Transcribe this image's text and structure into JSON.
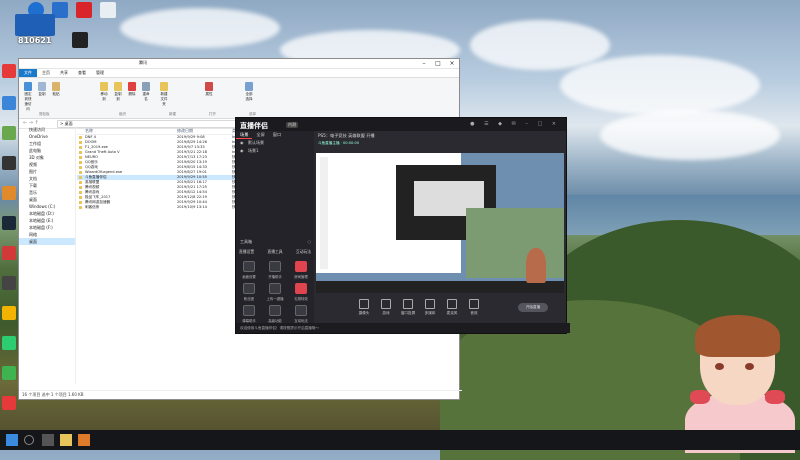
{
  "desktop": {
    "top_icons": [
      {
        "label": "",
        "color": "#cfd2d6"
      },
      {
        "label": "",
        "color": "#1e6fd0"
      },
      {
        "label": "",
        "color": "#2a6fc9"
      },
      {
        "label": "",
        "color": "#d9252a"
      },
      {
        "label": "",
        "color": "#3a7bd5"
      }
    ],
    "brand_text": "810621",
    "left_icons": [
      {
        "label": "",
        "color": "#e63a3a"
      },
      {
        "label": "",
        "color": "#3b86d8"
      },
      {
        "label": "",
        "color": "#6aa84f"
      },
      {
        "label": "",
        "color": "#333333"
      },
      {
        "label": "",
        "color": "#0f3d6e"
      },
      {
        "label": "",
        "color": "#e08a2b"
      },
      {
        "label": "",
        "color": "#1b2838"
      },
      {
        "label": "",
        "color": "#d23a3a"
      },
      {
        "label": "",
        "color": "#444444"
      },
      {
        "label": "",
        "color": "#f2b400"
      },
      {
        "label": "",
        "color": "#2ecc71"
      },
      {
        "label": "",
        "color": "#3fb34f"
      }
    ]
  },
  "explorer": {
    "title": "腾讯",
    "ribbon_tabs": [
      "文件",
      "主页",
      "共享",
      "查看",
      "管理"
    ],
    "ribbon_groups": [
      "剪贴板",
      "组织",
      "新建",
      "打开",
      "选择"
    ],
    "ribbon_buttons": [
      "固定到快速访问",
      "复制",
      "粘贴",
      "移动到",
      "复制到",
      "删除",
      "重命名",
      "新建文件夹",
      "属性",
      "全部选择"
    ],
    "address": "> 桌面",
    "search_placeholder": "搜索\"桌面\"",
    "nav": [
      {
        "label": "快速访问",
        "selected": false
      },
      {
        "label": "OneDrive",
        "selected": false
      },
      {
        "label": "工作组",
        "selected": false
      },
      {
        "label": "此电脑",
        "selected": false
      },
      {
        "label": "3D 对象",
        "selected": false
      },
      {
        "label": "视频",
        "selected": false
      },
      {
        "label": "图片",
        "selected": false
      },
      {
        "label": "文档",
        "selected": false
      },
      {
        "label": "下载",
        "selected": false
      },
      {
        "label": "音乐",
        "selected": false
      },
      {
        "label": "桌面",
        "selected": false
      },
      {
        "label": "Windows (C:)",
        "selected": false
      },
      {
        "label": "本地磁盘 (D:)",
        "selected": false
      },
      {
        "label": "本地磁盘 (E:)",
        "selected": false
      },
      {
        "label": "本地磁盘 (F:)",
        "selected": false
      },
      {
        "label": "网络",
        "selected": false
      },
      {
        "label": "桌面",
        "selected": true
      }
    ],
    "columns": [
      "名称",
      "修改日期",
      "类型",
      "大小"
    ],
    "files": [
      {
        "name": "DNF 4",
        "date": "2019/9/29 9:08",
        "type": "Internet 快捷方式",
        "size": "",
        "selected": false
      },
      {
        "name": "DOOM",
        "date": "2019/8/29 14:26",
        "type": "Internet 快捷方式",
        "size": "",
        "selected": false
      },
      {
        "name": "F1_2019.exe",
        "date": "2019/9/7 13:33",
        "type": "快捷方式",
        "size": "",
        "selected": false
      },
      {
        "name": "Grand Theft Auto V",
        "date": "2019/5/21 22:18",
        "type": "Internet 快捷方式",
        "size": "",
        "selected": false
      },
      {
        "name": "NEURO",
        "date": "2019/7/13 17:23",
        "type": "快捷方式",
        "size": "",
        "selected": false
      },
      {
        "name": "QQ音乐",
        "date": "2019/6/20 13:19",
        "type": "快捷方式",
        "size": "",
        "selected": false
      },
      {
        "name": "QQ游戏",
        "date": "2019/8/15 14:33",
        "type": "快捷方式",
        "size": "",
        "selected": false
      },
      {
        "name": "WizardOfLegend.exe",
        "date": "2019/8/27 19:01",
        "type": "快捷方式",
        "size": "",
        "selected": false
      },
      {
        "name": "斗鱼直播伴侣",
        "date": "2019/9/29 10:55",
        "type": "快捷方式",
        "size": "",
        "selected": true
      },
      {
        "name": "英雄联盟",
        "date": "2019/8/21 16:17",
        "type": "快捷方式",
        "size": "",
        "selected": false
      },
      {
        "name": "腾讯视频",
        "date": "2019/5/21 17:25",
        "type": "快捷方式",
        "size": "",
        "selected": false
      },
      {
        "name": "腾讯游戏",
        "date": "2019/8/12 14:54",
        "type": "快捷方式",
        "size": "",
        "selected": false
      },
      {
        "name": "极品飞车_2017",
        "date": "2019/12/8 22:19",
        "type": "快捷方式",
        "size": "",
        "selected": false
      },
      {
        "name": "腾讯网游加速器",
        "date": "2019/9/29 10:44",
        "type": "快捷方式",
        "size": "",
        "selected": false
      },
      {
        "name": "刺客信条",
        "date": "2019/10/9 13:14",
        "type": "快捷方式",
        "size": "",
        "selected": false
      }
    ],
    "status": "16 个项目   选中 1 个项目  1.60 KB"
  },
  "stream": {
    "logo": "直播伴侣",
    "badge": "内测",
    "left_tabs": [
      "场景",
      "全屏",
      "窗口"
    ],
    "scenes": [
      "默认场景",
      "场景1"
    ],
    "tools_title": "工具箱",
    "tool_tabs": [
      "直播设置",
      "直播工具",
      "互动玩法"
    ],
    "tools": [
      "画面设置",
      "开播助手",
      "房间管理",
      "粉丝团",
      "上传一键播",
      "礼物特效",
      "弹幕助手",
      "高级功能",
      "互动玩法"
    ],
    "info_line": "PS5：电子竞技 英雄联盟   开播",
    "info_sub": "斗鱼直播主播 · 00:00:00",
    "controls": [
      "摄像头",
      "游戏",
      "窗口投屏",
      "多媒体",
      "麦克风",
      "音效"
    ],
    "live_button": "开始直播",
    "bottom_text": "欢迎使用斗鱼直播伴侣！请按照提示开启直播哦～"
  },
  "colors": {
    "accent_red": "#e0444f",
    "explorer_blue": "#1979ca"
  }
}
